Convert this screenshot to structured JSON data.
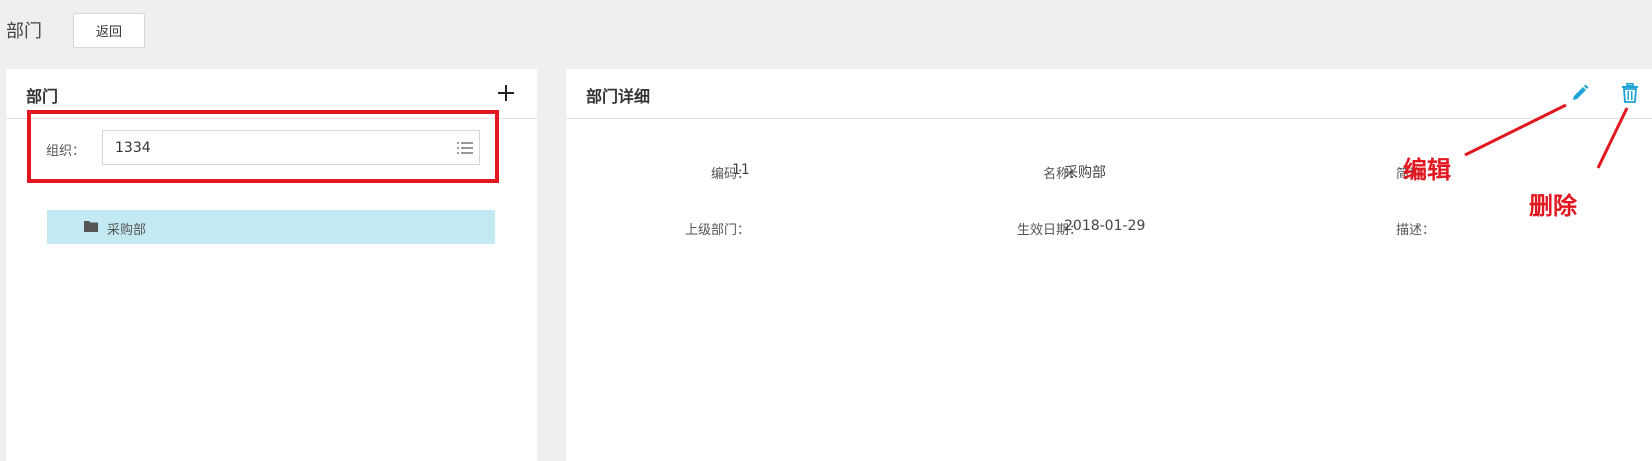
{
  "topbar": {
    "title": "部门",
    "back_label": "返回"
  },
  "left_panel": {
    "title": "部门",
    "org_label": "组织：",
    "org_value": "1334",
    "tree": [
      {
        "label": "采购部"
      }
    ]
  },
  "right_panel": {
    "title": "部门详细",
    "fields": {
      "code_label": "编码：",
      "code_value": "11",
      "name_label": "名称：",
      "name_value": "采购部",
      "abbr_label": "简称：",
      "abbr_value": "",
      "parent_label": "上级部门：",
      "parent_value": "",
      "date_label": "生效日期：",
      "date_value": "2018-01-29",
      "desc_label": "描述：",
      "desc_value": ""
    }
  },
  "annotations": {
    "edit": "编辑",
    "delete": "删除"
  },
  "colors": {
    "accent": "#1ea3d6",
    "annotation": "#e3171f",
    "selected_row": "#c3e9f3"
  }
}
